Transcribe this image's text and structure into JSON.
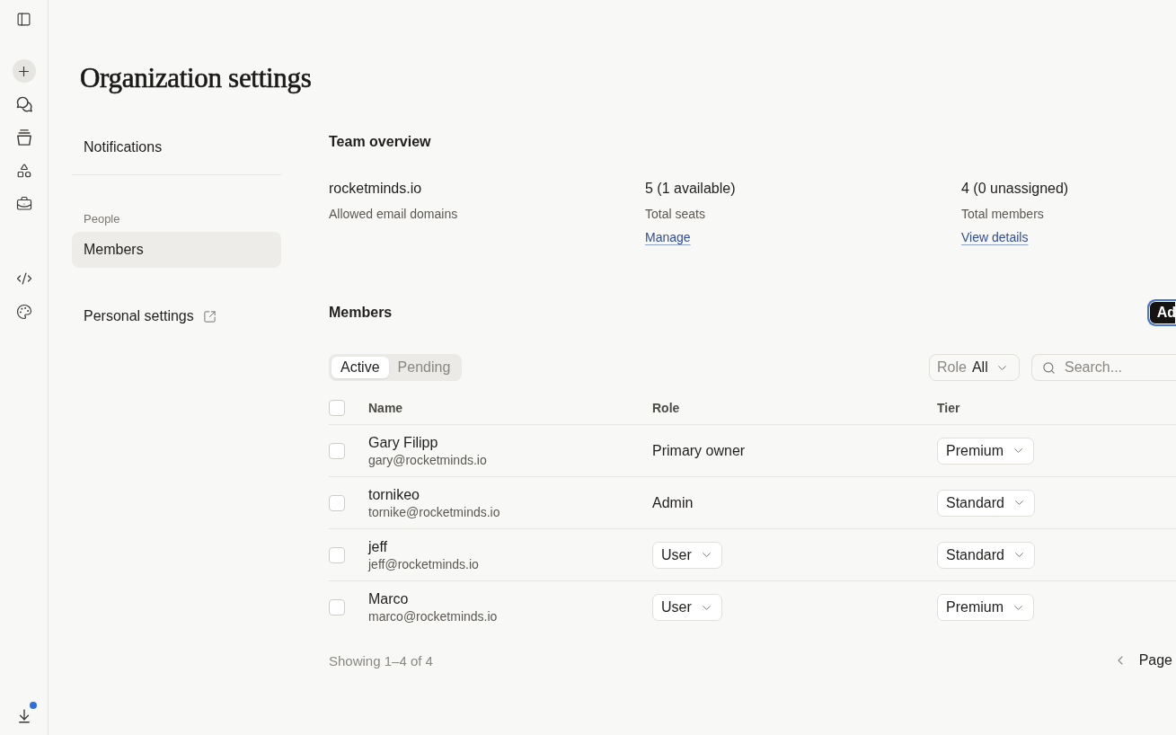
{
  "rail": {
    "update_dot": true
  },
  "page": {
    "title": "Organization settings"
  },
  "nav": {
    "groups": [
      {
        "items": [
          {
            "label": "Notifications",
            "selected": false
          }
        ]
      },
      {
        "heading": "People",
        "items": [
          {
            "label": "Members",
            "selected": true
          }
        ]
      }
    ],
    "external_link": {
      "label": "Personal settings"
    }
  },
  "team_overview": {
    "title": "Team overview",
    "stats": [
      {
        "value": "rocketminds.io",
        "label": "Allowed email domains"
      },
      {
        "value": "5 (1 available)",
        "label": "Total seats",
        "link": "Manage"
      },
      {
        "value": "4 (0 unassigned)",
        "label": "Total members",
        "link": "View details"
      }
    ]
  },
  "members": {
    "title": "Members",
    "add_button": "Ad",
    "tabs": [
      {
        "label": "Active",
        "selected": true
      },
      {
        "label": "Pending",
        "selected": false
      }
    ],
    "role_filter": {
      "label": "Role",
      "value": "All"
    },
    "search": {
      "placeholder": "Search..."
    },
    "table": {
      "select_all": {
        "checked": false
      },
      "columns": [
        "Name",
        "Role",
        "Tier"
      ],
      "rows": [
        {
          "checked": false,
          "name": "Gary Filipp",
          "email": "gary@rocketminds.io",
          "role": {
            "kind": "text",
            "value": "Primary owner"
          },
          "tier": "Premium"
        },
        {
          "checked": false,
          "name": "tornikeo",
          "email": "tornike@rocketminds.io",
          "role": {
            "kind": "text",
            "value": "Admin"
          },
          "tier": "Standard"
        },
        {
          "checked": false,
          "name": "jeff",
          "email": "jeff@rocketminds.io",
          "role": {
            "kind": "dropdown",
            "value": "User"
          },
          "tier": "Standard"
        },
        {
          "checked": false,
          "name": "Marco",
          "email": "marco@rocketminds.io",
          "role": {
            "kind": "dropdown",
            "value": "User"
          },
          "tier": "Premium"
        }
      ]
    },
    "footer": {
      "summary": "Showing 1–4 of 4",
      "page_label": "Page"
    }
  }
}
